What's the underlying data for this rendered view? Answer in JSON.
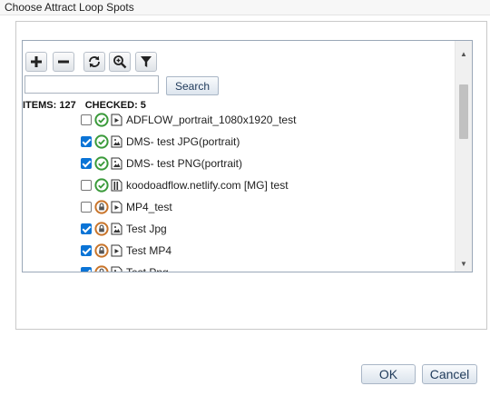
{
  "dialog": {
    "title": "Choose Attract Loop Spots"
  },
  "toolbar": {
    "add": "plus-icon",
    "remove": "minus-icon",
    "refresh": "refresh-icon",
    "zoom": "zoom-icon",
    "filter": "filter-icon"
  },
  "search": {
    "value": "",
    "placeholder": "",
    "button_label": "Search"
  },
  "counts": {
    "items_label": "ITEMS: 127",
    "checked_label": "CHECKED: 5"
  },
  "items": [
    {
      "label": "ADFLOW_portrait_1080x1920_test",
      "checked": false,
      "status": "approved",
      "type": "video"
    },
    {
      "label": "DMS- test JPG(portrait)",
      "checked": true,
      "status": "approved",
      "type": "image"
    },
    {
      "label": "DMS- test PNG(portrait)",
      "checked": true,
      "status": "approved",
      "type": "image"
    },
    {
      "label": "koodoadflow.netlify.com [MG] test",
      "checked": false,
      "status": "approved",
      "type": "web"
    },
    {
      "label": "MP4_test",
      "checked": false,
      "status": "locked",
      "type": "video"
    },
    {
      "label": "Test Jpg",
      "checked": true,
      "status": "locked",
      "type": "image"
    },
    {
      "label": "Test MP4",
      "checked": true,
      "status": "locked",
      "type": "video"
    },
    {
      "label": "Test Png",
      "checked": true,
      "status": "locked",
      "type": "image"
    }
  ],
  "footer": {
    "ok_label": "OK",
    "cancel_label": "Cancel"
  },
  "colors": {
    "approved": "#3a9a3a",
    "locked": "#c8742a",
    "checkbox": "#0b74d6",
    "accent": "#1f3a5a"
  }
}
